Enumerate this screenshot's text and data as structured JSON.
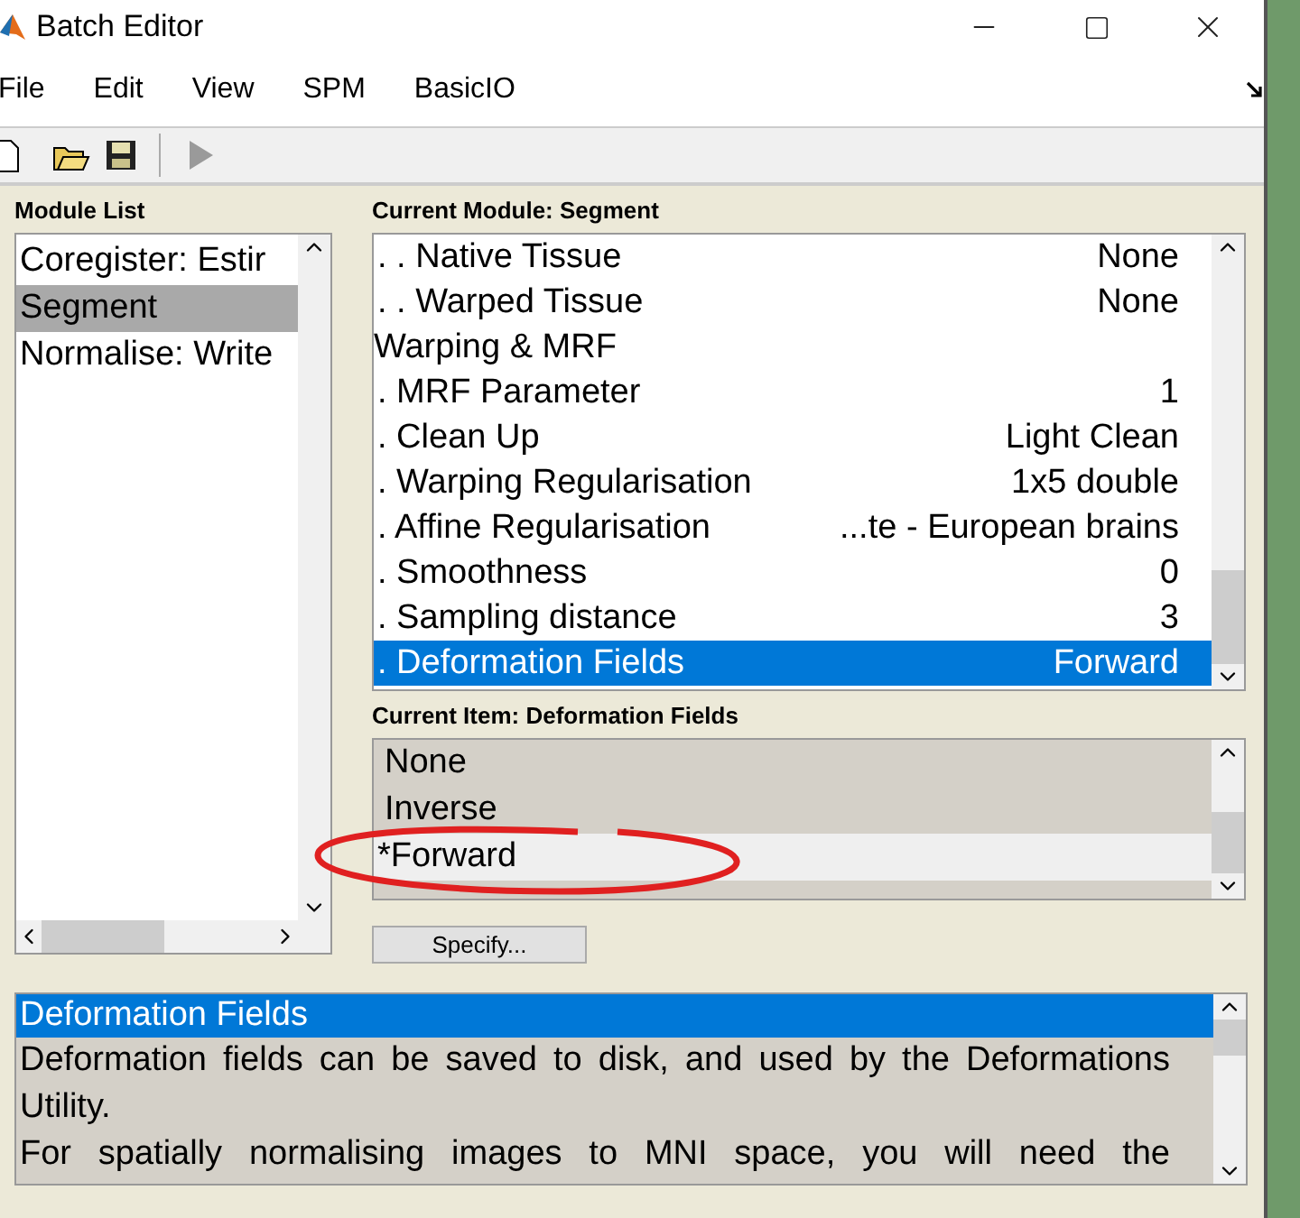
{
  "window": {
    "title": "Batch Editor"
  },
  "menu": [
    "File",
    "Edit",
    "View",
    "SPM",
    "BasicIO"
  ],
  "toolbar": [
    {
      "kind": "new",
      "disabled": false
    },
    {
      "kind": "open",
      "disabled": false
    },
    {
      "kind": "save",
      "disabled": false
    },
    {
      "kind": "run",
      "disabled": true
    }
  ],
  "module_list": {
    "title": "Module List",
    "items": [
      {
        "label": "Coregister: Estir",
        "selected": false
      },
      {
        "label": "Segment",
        "selected": true
      },
      {
        "label": "Normalise: Write",
        "selected": false
      }
    ]
  },
  "current_module": {
    "title": "Current Module: Segment",
    "rows": [
      {
        "kind": "item",
        "label": ". . Native Tissue",
        "value": "None",
        "selected": false
      },
      {
        "kind": "item",
        "label": ". . Warped Tissue",
        "value": "None",
        "selected": false
      },
      {
        "kind": "heading",
        "label": "Warping & MRF",
        "value": "",
        "selected": false
      },
      {
        "kind": "item",
        "label": ". MRF Parameter",
        "value": "1",
        "selected": false
      },
      {
        "kind": "item",
        "label": ". Clean Up",
        "value": "Light Clean",
        "selected": false
      },
      {
        "kind": "item",
        "label": ". Warping Regularisation",
        "value": "1x5 double",
        "selected": false
      },
      {
        "kind": "item",
        "label": ". Affine Regularisation",
        "value": "...te - European brains",
        "selected": false
      },
      {
        "kind": "item",
        "label": ". Smoothness",
        "value": "0",
        "selected": false
      },
      {
        "kind": "item",
        "label": ". Sampling distance",
        "value": "3",
        "selected": false
      },
      {
        "kind": "item",
        "label": ". Deformation Fields",
        "value": "Forward",
        "selected": true
      }
    ]
  },
  "current_item": {
    "title": "Current Item: Deformation Fields",
    "options": [
      {
        "label": "None",
        "selected": false
      },
      {
        "label": "Inverse",
        "selected": false
      },
      {
        "label": "*Forward",
        "selected": true
      }
    ]
  },
  "specify_button": "Specify...",
  "help": {
    "title": "Deformation Fields",
    "paragraphs": [
      "Deformation fields can be saved to disk, and used by the Deformations Utility.",
      "For spatially normalising images to MNI space, you will need the"
    ]
  },
  "annotation": {
    "kind": "ellipse",
    "color": "#e02020"
  }
}
